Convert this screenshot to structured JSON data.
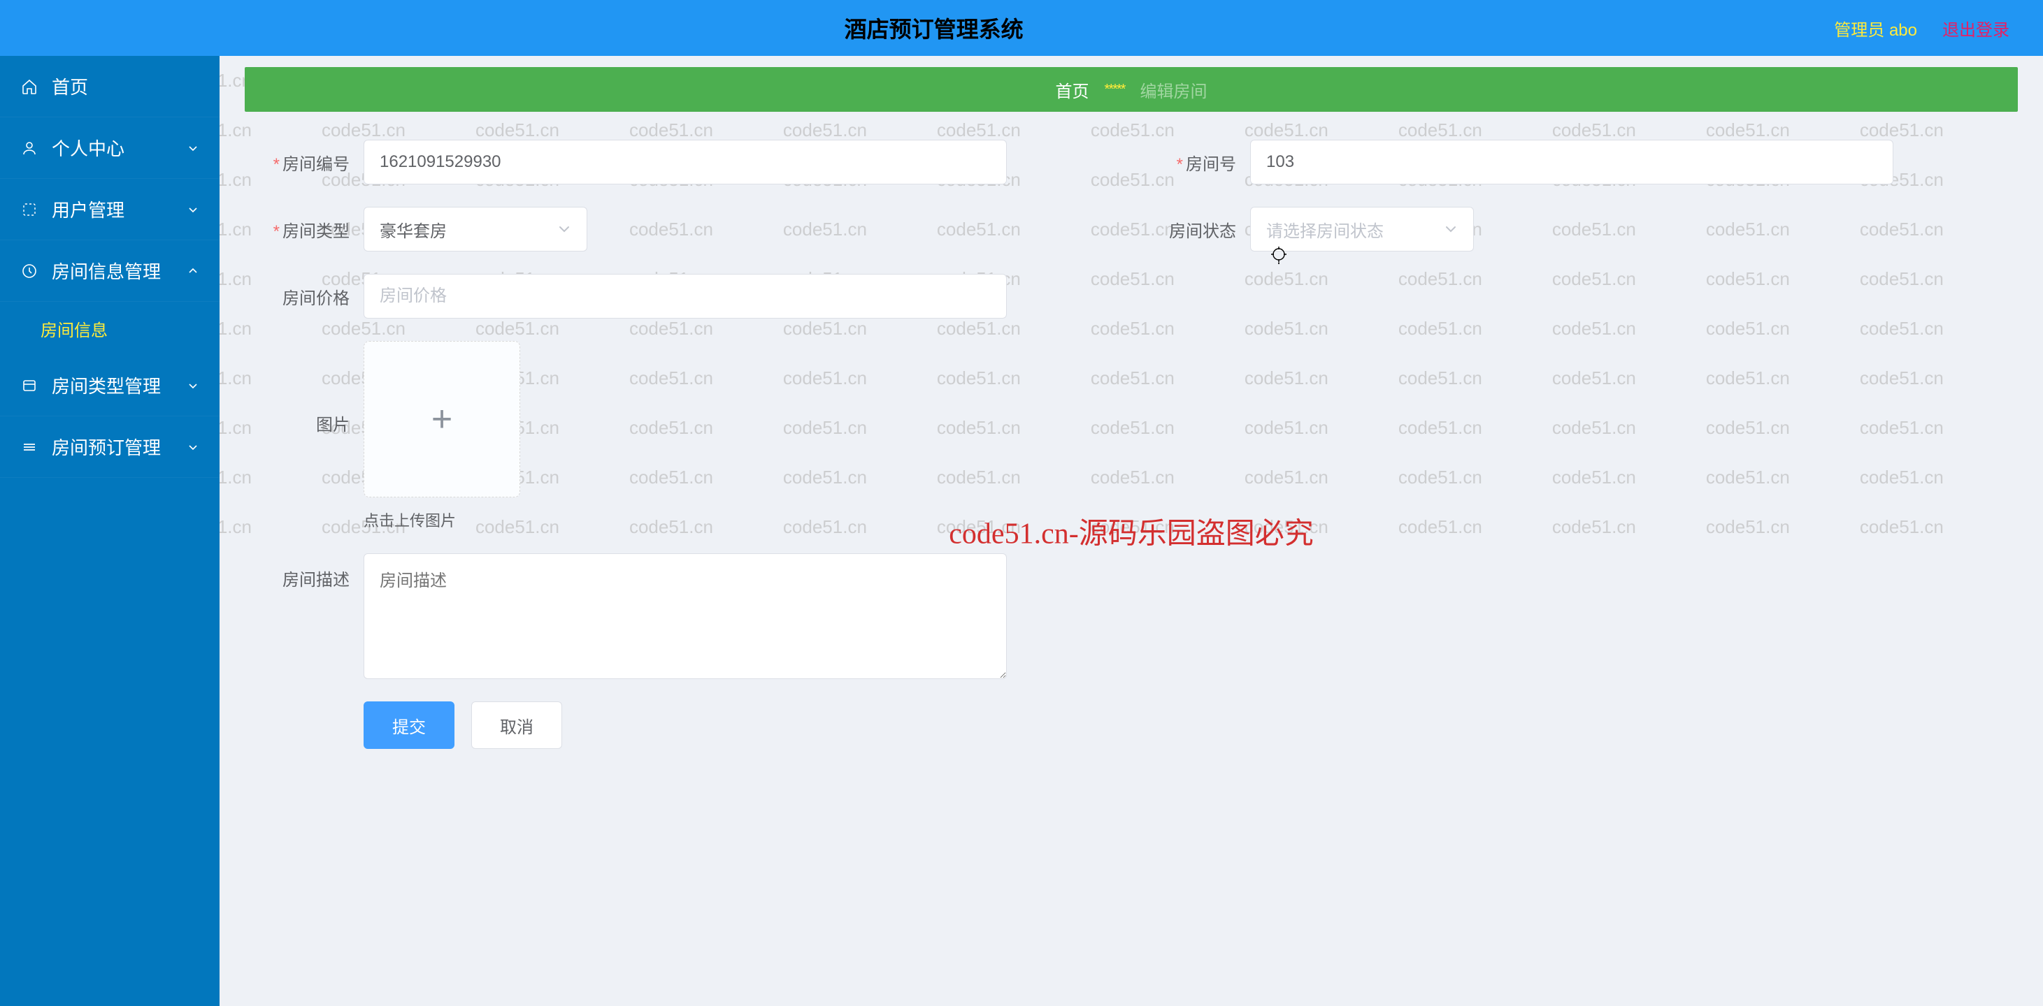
{
  "watermark_text": "code51.cn",
  "watermark_count": 130,
  "header": {
    "title": "酒店预订管理系统",
    "admin": "管理员 abo",
    "logout": "退出登录"
  },
  "sidebar": [
    {
      "icon": "home",
      "label": "首页",
      "expandable": false
    },
    {
      "icon": "user",
      "label": "个人中心",
      "expandable": true
    },
    {
      "icon": "users",
      "label": "用户管理",
      "expandable": true
    },
    {
      "icon": "room",
      "label": "房间信息管理",
      "expandable": true,
      "open": true,
      "children": [
        {
          "label": "房间信息",
          "active": true
        }
      ]
    },
    {
      "icon": "type",
      "label": "房间类型管理",
      "expandable": true
    },
    {
      "icon": "booking",
      "label": "房间预订管理",
      "expandable": true
    }
  ],
  "breadcrumb": {
    "a": "首页",
    "sep": "*****",
    "b": "编辑房间"
  },
  "form": {
    "room_code_label": "房间编号",
    "room_code_value": "1621091529930",
    "room_no_label": "房间号",
    "room_no_value": "103",
    "room_type_label": "房间类型",
    "room_type_value": "豪华套房",
    "room_status_label": "房间状态",
    "room_status_placeholder": "请选择房间状态",
    "room_price_label": "房间价格",
    "room_price_placeholder": "房间价格",
    "image_label": "图片",
    "image_hint": "点击上传图片",
    "image_plus": "+",
    "desc_label": "房间描述",
    "desc_placeholder": "房间描述",
    "submit": "提交",
    "cancel": "取消"
  },
  "center_watermark": "code51.cn-源码乐园盗图必究"
}
